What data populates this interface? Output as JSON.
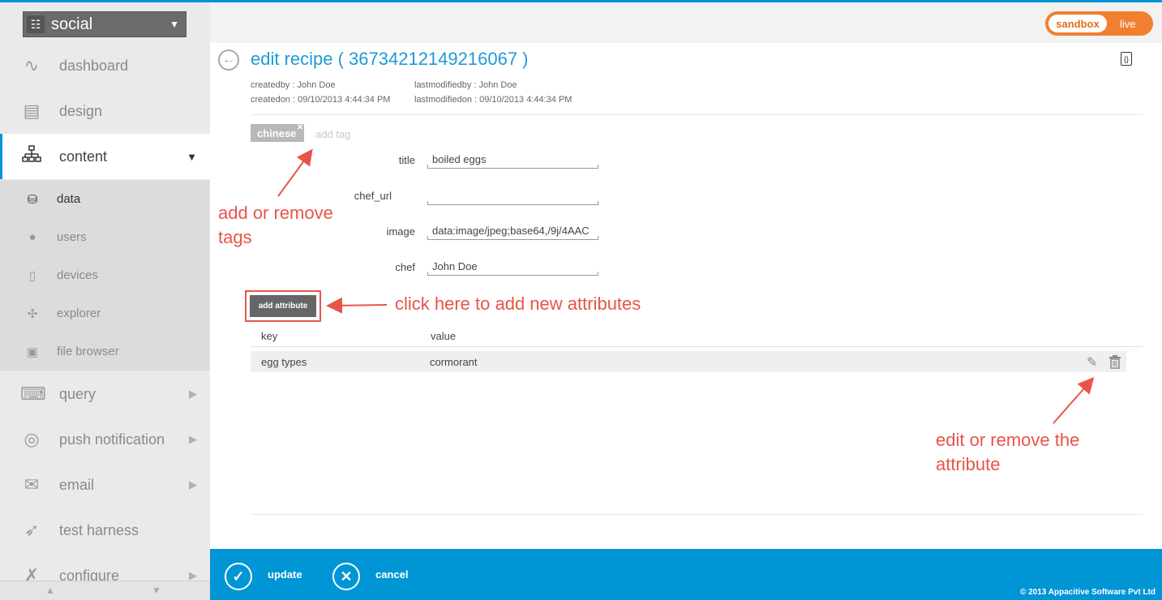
{
  "app": {
    "name": "social",
    "grid_icon": "grid-icon",
    "caret_icon": "caret-down-icon"
  },
  "env": {
    "sandbox": "sandbox",
    "live": "live",
    "accent": "#f08030"
  },
  "sidebar": {
    "items": [
      {
        "label": "dashboard",
        "icon": "pulse-icon"
      },
      {
        "label": "design",
        "icon": "design-icon"
      },
      {
        "label": "content",
        "icon": "sitemap-icon",
        "active": true
      },
      {
        "label": "query",
        "icon": "terminal-icon"
      },
      {
        "label": "push notification",
        "icon": "broadcast-icon"
      },
      {
        "label": "email",
        "icon": "envelope-icon"
      },
      {
        "label": "test harness",
        "icon": "rocket-icon"
      },
      {
        "label": "configure",
        "icon": "tools-icon"
      }
    ],
    "subitems": [
      {
        "label": "data",
        "icon": "database-icon",
        "active": true
      },
      {
        "label": "users",
        "icon": "user-icon"
      },
      {
        "label": "devices",
        "icon": "device-icon"
      },
      {
        "label": "explorer",
        "icon": "network-icon"
      },
      {
        "label": "file browser",
        "icon": "file-icon"
      }
    ]
  },
  "page": {
    "title": "edit recipe ( 36734212149216067 )",
    "createdby": "createdby : John Doe",
    "createdon": "createdon : 09/10/2013 4:44:34 PM",
    "lastmodifiedby": "lastmodifiedby : John Doe",
    "lastmodifiedon": "lastmodifiedon : 09/10/2013 4:44:34 PM"
  },
  "tags": {
    "items": [
      "chinese"
    ],
    "add_placeholder": "add tag"
  },
  "fields": [
    {
      "label": "title",
      "value": "boiled eggs"
    },
    {
      "label": "chef_url",
      "value": ""
    },
    {
      "label": "image",
      "value": "data:image/jpeg;base64,/9j/4AAC"
    },
    {
      "label": "chef",
      "value": "John Doe"
    }
  ],
  "attributes": {
    "add_label": "add attribute",
    "key_header": "key",
    "value_header": "value",
    "rows": [
      {
        "key": "egg types",
        "value": "cormorant"
      }
    ]
  },
  "annotations": {
    "tags": "add or remove tags",
    "add_attr": "click here to add new attributes",
    "edit_attr": "edit or remove the attribute",
    "color": "#e8544a"
  },
  "footer": {
    "update": "update",
    "cancel": "cancel",
    "copyright": "© 2013 Appacitive Software Pvt Ltd",
    "color": "#0096d6"
  }
}
